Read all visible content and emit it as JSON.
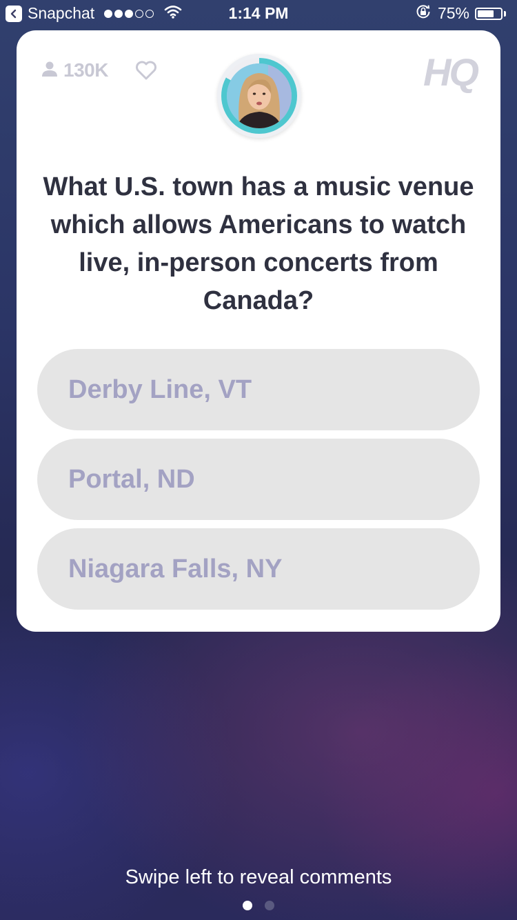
{
  "status_bar": {
    "back_app": "Snapchat",
    "time": "1:14 PM",
    "battery_percent": "75%",
    "battery_level": 0.75,
    "signal_bars_filled": 3,
    "signal_bars_total": 5
  },
  "card": {
    "viewer_count": "130K",
    "logo": "HQ",
    "host_timer_fraction": 0.83,
    "question": "What U.S. town has a music venue which allows Americans to watch live, in-person concerts from Canada?",
    "answers": [
      {
        "label": "Derby Line, VT"
      },
      {
        "label": "Portal, ND"
      },
      {
        "label": "Niagara Falls, NY"
      }
    ]
  },
  "footer": {
    "swipe_hint": "Swipe left to reveal comments",
    "pages_total": 2,
    "current_page": 1
  },
  "colors": {
    "timer_accent": "#4ec7cf",
    "answer_bg": "#e5e5e5",
    "answer_text": "#a3a2c3",
    "question_text": "#2f3140"
  },
  "icons": [
    "back-arrow-icon",
    "wifi-icon",
    "rotation-lock-icon",
    "battery-icon",
    "person-icon",
    "heart-icon"
  ]
}
